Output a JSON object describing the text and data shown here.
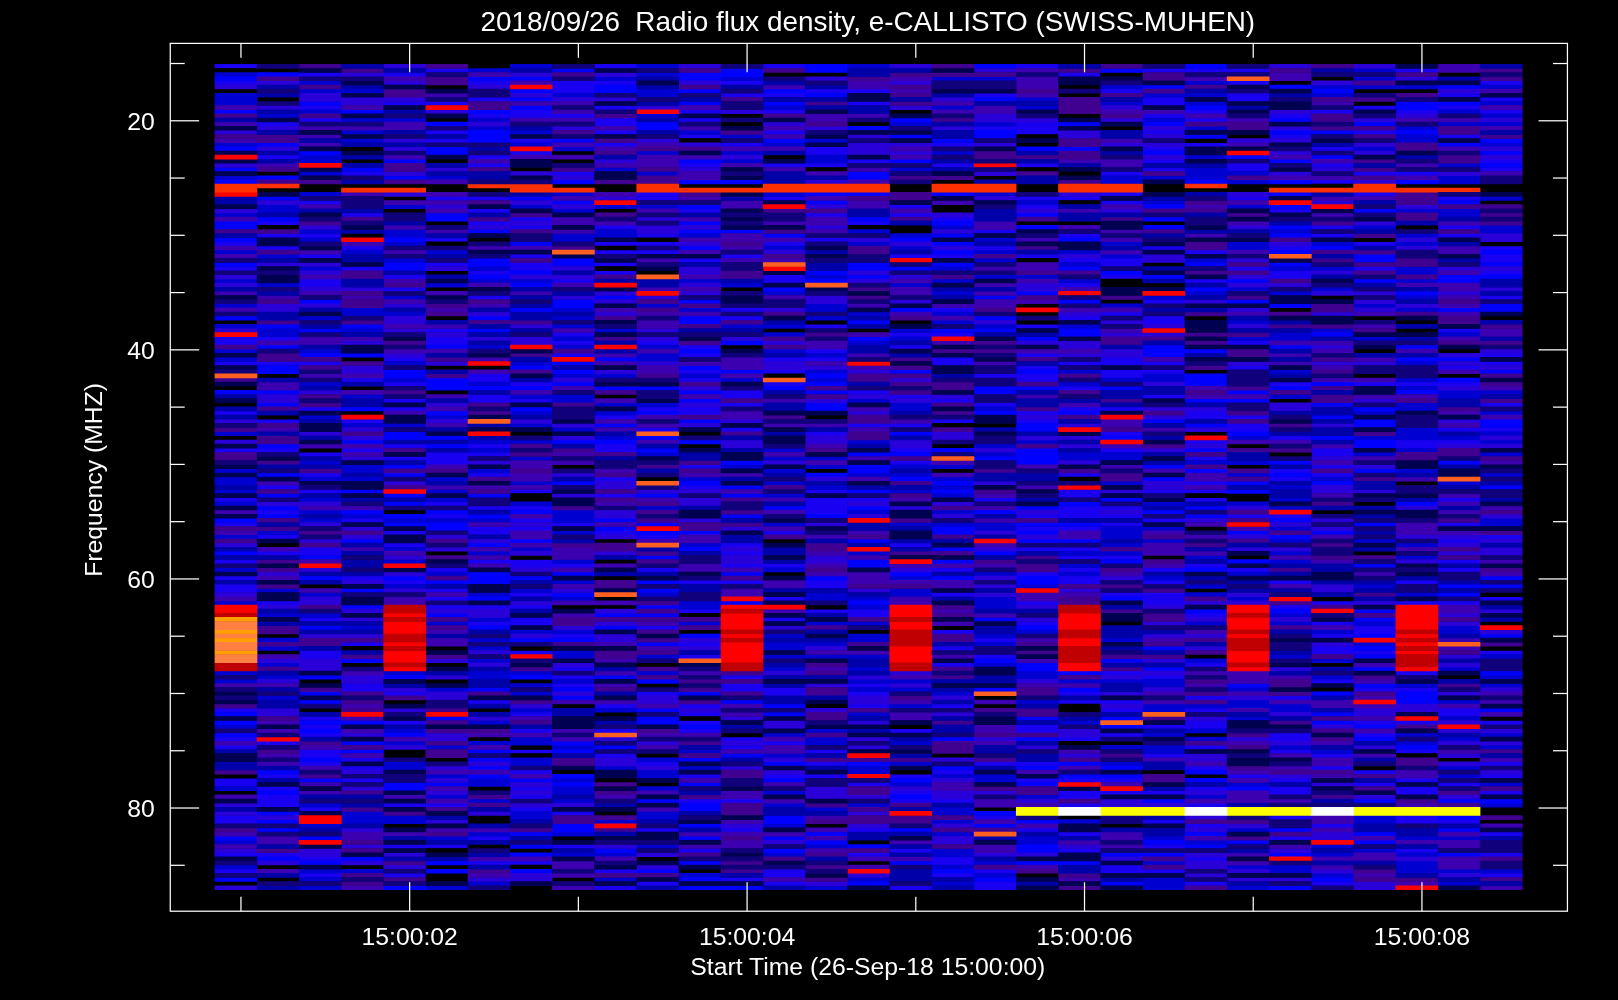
{
  "title": "2018/09/26  Radio flux density, e-CALLISTO (SWISS-MUHEN)",
  "ylabel": "Frequency (MHZ)",
  "xlabel": "Start Time (26-Sep-18 15:00:00)",
  "yticks": [
    "20",
    "40",
    "60",
    "80"
  ],
  "xticks": [
    "15:00:02",
    "15:00:04",
    "15:00:06",
    "15:00:08"
  ]
}
